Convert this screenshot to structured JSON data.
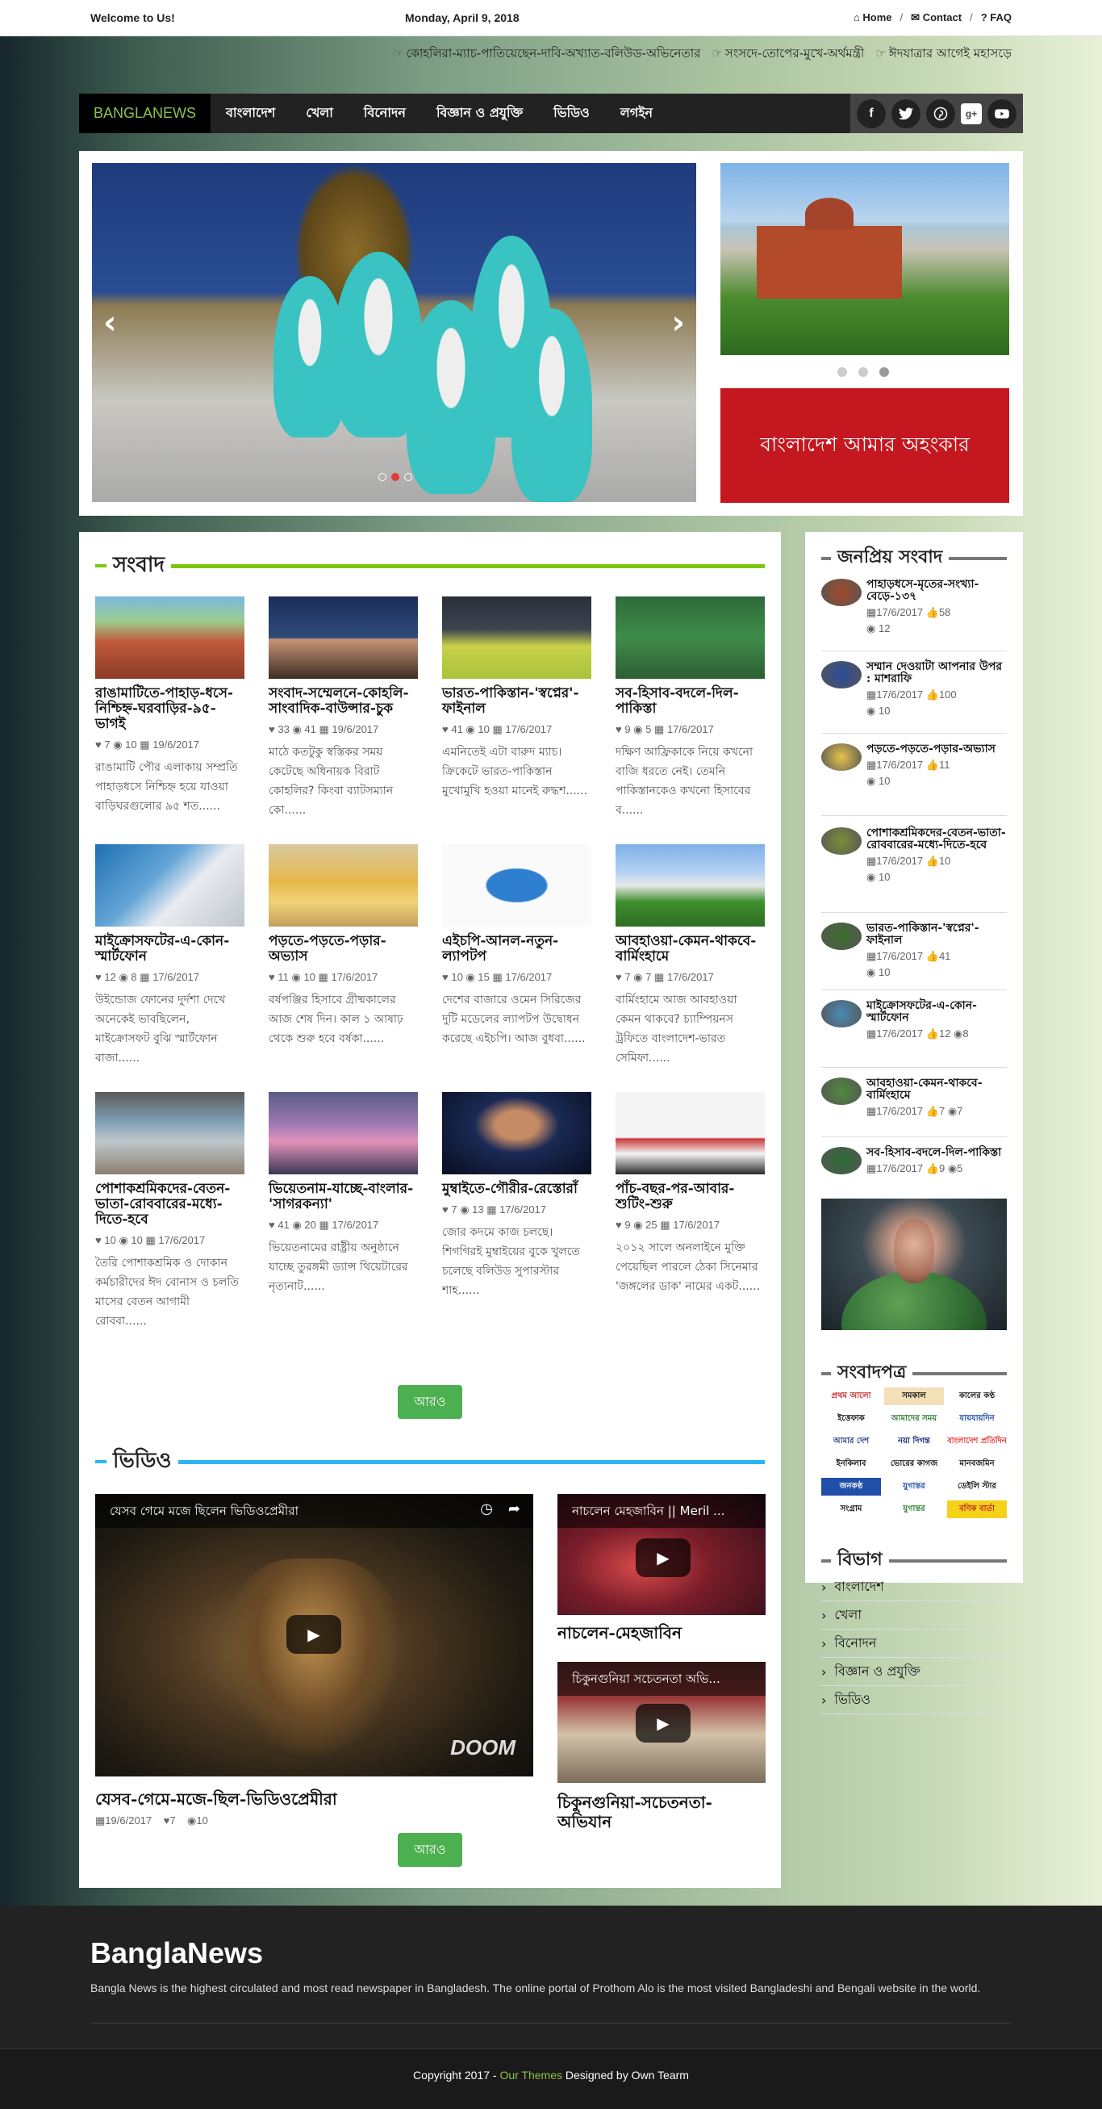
{
  "topbar": {
    "welcome": "Welcome to Us!",
    "date": "Monday, April 9, 2018",
    "links": [
      "Home",
      "Contact",
      "FAQ"
    ]
  },
  "ticker": [
    "কোহলিরা-ম্যাচ-পাতিয়েছেন-দাবি-অখ্যাত-বলিউড-অভিনেতার",
    "সংসদে-তোপের-মুখে-অর্থমন্ত্রী",
    "ঈদযাত্রার আগেই মহাসড়ে"
  ],
  "nav": {
    "brand": "BANGLANEWS",
    "items": [
      "বাংলাদেশ",
      "খেলা",
      "বিনোদন",
      "বিজ্ঞান ও প্রযুক্তি",
      "ভিডিও",
      "লগইন"
    ],
    "social": [
      "f",
      "t",
      "p",
      "g+",
      "yt"
    ]
  },
  "banner_text": "বাংলাদেশ আমার অহংকার",
  "news_section": {
    "title": "সংবাদ",
    "accent": "#7ac70c",
    "cards": [
      {
        "title": "রাঙামাটিতে-পাহাড়-ধসে-নিশ্চিহ্ন-ঘরবাড়ির-৯৫-ভাগই",
        "likes": "7",
        "views": "10",
        "date": "19/6/2017",
        "desc": "রাঙামাটি পৌর এলাকায় সম্প্রতি পাহাড়ধসে নিশ্চিহ্ন হয়ে যাওয়া বাড়িঘরগুলোর ৯৫ শত......"
      },
      {
        "title": "সংবাদ-সম্মেলনে-কোহলি-সাংবাদিক-বাউন্সার-চুক",
        "likes": "33",
        "views": "41",
        "date": "19/6/2017",
        "desc": "মাঠে কতটুকু স্বস্তিকর সময় কেটেছে অধিনায়ক বিরাট কোহলির? কিংবা ব্যাটসম্যান কো......"
      },
      {
        "title": "ভারত-পাকিস্তান-'স্বপ্নের'-ফাইনাল",
        "likes": "41",
        "views": "10",
        "date": "17/6/2017",
        "desc": "এমনিতেই এটা বারুদ ম্যাচ। ক্রিকেটে ভারত-পাকিস্তান মুখোমুখি হওয়া মানেই রুদ্ধশ......"
      },
      {
        "title": "সব-হিসাব-বদলে-দিল-পাকিস্তা",
        "likes": "9",
        "views": "5",
        "date": "17/6/2017",
        "desc": "দক্ষিণ আফ্রিকাকে নিয়ে কখনো বাজি ধরতে নেই। তেমনি পাকিস্তানকেও কখনো হিসাবের ব......"
      },
      {
        "title": "মাইক্রোসফটের-এ-কোন-স্মার্টফোন",
        "likes": "12",
        "views": "8",
        "date": "17/6/2017",
        "desc": "উইন্ডোজ ফোনের দুর্দশা দেখে অনেকেই ভাবছিলেন, মাইক্রোসফট বুঝি স্মার্টফোন বাজা......"
      },
      {
        "title": "পড়তে-পড়তে-পড়ার-অভ্যাস",
        "likes": "11",
        "views": "10",
        "date": "17/6/2017",
        "desc": "বর্ষপঞ্জির হিসাবে গ্রীষ্মকালের আজ শেষ দিন। কাল ১ আষাঢ় থেকে শুরু হবে বর্ষকা......"
      },
      {
        "title": "এইচপি-আনল-নতুন-ল্যাপটপ",
        "likes": "10",
        "views": "15",
        "date": "17/6/2017",
        "desc": "দেশের বাজারে ওমেন সিরিজের দুটি মডেলের ল্যাপটপ উদ্বোধন করেছে এইচপি। আজ বুধবা......"
      },
      {
        "title": "আবহাওয়া-কেমন-থাকবে-বার্মিংহামে",
        "likes": "7",
        "views": "7",
        "date": "17/6/2017",
        "desc": "বার্মিংহামে আজ আবহাওয়া কেমন থাকবে? চ্যাম্পিয়নস ট্রফিতে বাংলাদেশ-ভারত সেমিফা......"
      },
      {
        "title": "পোশাকশ্রমিকদের-বেতন-ভাতা-রোববারের-মধ্যে-দিতে-হবে",
        "likes": "10",
        "views": "10",
        "date": "17/6/2017",
        "desc": "তৈরি পোশাকশ্রমিক ও দোকান কর্মচারীদের ঈদ বোনাস ও চলতি মাসের বেতন আগামী রোববা......"
      },
      {
        "title": "ভিয়েতনাম-যাচ্ছে-বাংলার-'সাগরকন্যা'",
        "likes": "41",
        "views": "20",
        "date": "17/6/2017",
        "desc": "ভিয়েতনামের রাষ্ট্রীয় অনুষ্ঠানে যাচ্ছে তুরঙ্গমী ড্যান্স থিয়েটারের নৃত্যনাট......"
      },
      {
        "title": "মুম্বাইতে-গৌরীর-রেস্তোরাঁ",
        "likes": "7",
        "views": "13",
        "date": "17/6/2017",
        "desc": "জোর কদমে কাজ চলছে। শিগগিরই মুম্বাইয়ের বুকে খুলতে চলেছে বলিউড সুপারস্টার শাহ......"
      },
      {
        "title": "পাঁচ-বছর-পর-আবার-শুটিং-শুরু",
        "likes": "9",
        "views": "25",
        "date": "17/6/2017",
        "desc": "২০১২ সালে অনলাইনে মুক্তি পেয়েছিল পারলে ঠেকা সিনেমার 'জঙ্গলের ডাক' নামের একট......"
      }
    ],
    "more_label": "আরও"
  },
  "video_section": {
    "title": "ভিডিও",
    "accent": "#29b6f6",
    "big": {
      "overlay": "যেসব গেমে মজে ছিলেন ভিডিওপ্রেমীরা",
      "title": "যেসব-গেমে-মজে-ছিল-ভিডিওপ্রেমীরা",
      "date": "19/6/2017",
      "likes": "7",
      "views": "10",
      "logo": "DOOM"
    },
    "small": [
      {
        "overlay": "নাচলেন মেহজাবিন || Meril ...",
        "title": "নাচলেন-মেহজাবিন"
      },
      {
        "overlay": "চিকুনগুনিয়া সচেতনতা অভি...",
        "title": "চিকুনগুনিয়া-সচেতনতা-অভিযান"
      }
    ],
    "more_label": "আরও"
  },
  "sidebar": {
    "popular_title": "জনপ্রিয় সংবাদ",
    "popular": [
      {
        "title": "পাহাড়ধসে-মৃতের-সংখ্যা-বেড়ে-১৩৭",
        "date": "17/6/2017",
        "likes": "58",
        "views": "12"
      },
      {
        "title": "সম্মান দেওয়াটা আপনার উপর : মাশরাফি",
        "date": "17/6/2017",
        "likes": "100",
        "views": "10"
      },
      {
        "title": "পড়তে-পড়তে-পড়ার-অভ্যাস",
        "date": "17/6/2017",
        "likes": "11",
        "views": "10"
      },
      {
        "title": "পোশাকশ্রমিকদের-বেতন-ভাতা-রোববারের-মধ্যে-দিতে-হবে",
        "date": "17/6/2017",
        "likes": "10",
        "views": "10"
      },
      {
        "title": "ভারত-পাকিস্তান-'স্বপ্নের'-ফাইনাল",
        "date": "17/6/2017",
        "likes": "41",
        "views": "10"
      },
      {
        "title": "মাইক্রোসফটের-এ-কোন-স্মার্টফোন",
        "date": "17/6/2017",
        "likes": "12",
        "views": "8"
      },
      {
        "title": "আবহাওয়া-কেমন-থাকবে-বার্মিংহামে",
        "date": "17/6/2017",
        "likes": "7",
        "views": "7"
      },
      {
        "title": "সব-হিসাব-বদলে-দিল-পাকিস্তা",
        "date": "17/6/2017",
        "likes": "9",
        "views": "5"
      }
    ],
    "newspapers_title": "সংবাদপত্র",
    "newspapers": [
      "প্রথম আলো",
      "সমকাল",
      "কালের কণ্ঠ",
      "ইত্তেফাক",
      "আমাদের সময়",
      "যায়যায়দিন",
      "আমার দেশ",
      "নয়া দিগন্ত",
      "বাংলাদেশ প্রতিদিন",
      "ইনকিলাব",
      "ভোরের কাগজ",
      "মানবজমিন",
      "জনকণ্ঠ",
      "যুগান্তর",
      "ডেইলি স্টার",
      "সংগ্রাম",
      "যুগান্তর",
      "বণিক বার্তা"
    ],
    "categories_title": "বিভাগ",
    "categories": [
      "বাংলাদেশ",
      "খেলা",
      "বিনোদন",
      "বিজ্ঞান ও প্রযুক্তি",
      "ভিডিও"
    ]
  },
  "footer": {
    "title": "BanglaNews",
    "desc": "Bangla News is the highest circulated and most read newspaper in Bangladesh. The online portal of Prothom Alo is the most visited Bangladeshi and Bengali website in the world.",
    "copy_pre": "Copyright 2017 - ",
    "copy_link": "Our Themes",
    "copy_post": " Designed by Own Tearm"
  }
}
